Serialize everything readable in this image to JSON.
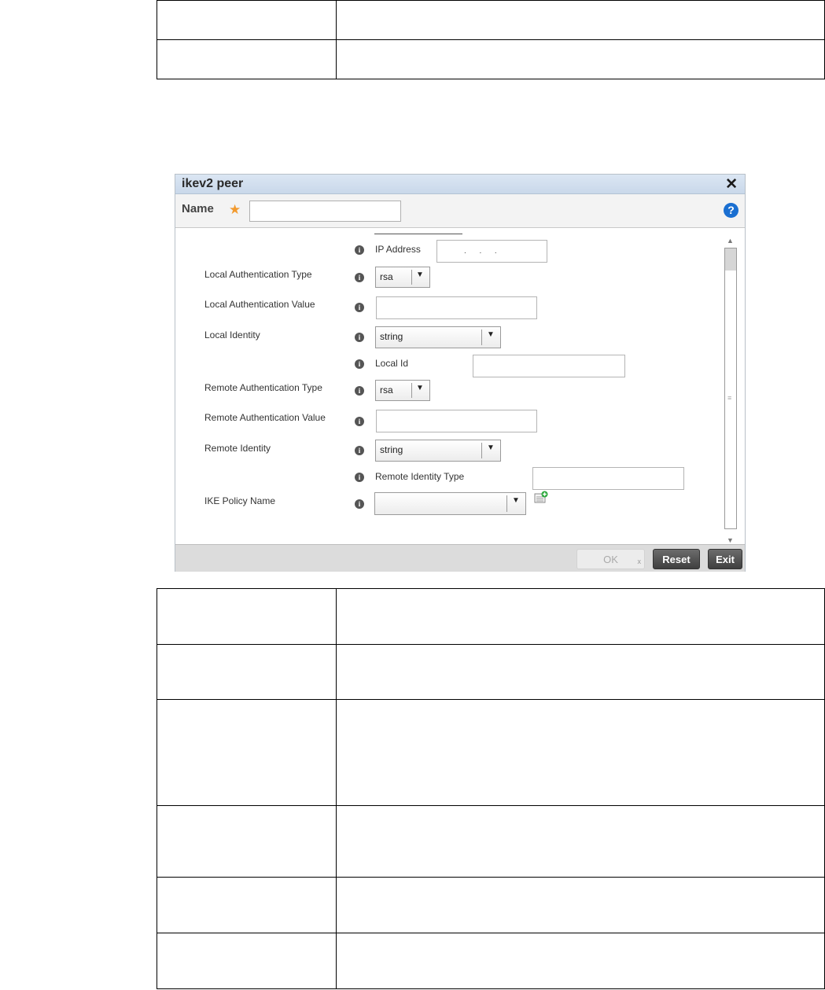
{
  "dialog": {
    "title": "ikev2 peer",
    "close_glyph": "✕",
    "name_label": "Name",
    "required_marker": "★",
    "help_glyph": "?",
    "name_value": ""
  },
  "form": {
    "ip_address_label": "IP Address",
    "ip_address_value": ".      .      .",
    "local_auth_type_label": "Local Authentication Type",
    "local_auth_type_value": "rsa",
    "local_auth_value_label": "Local Authentication Value",
    "local_identity_label": "Local Identity",
    "local_identity_value": "string",
    "local_id_label": "Local Id",
    "remote_auth_type_label": "Remote Authentication Type",
    "remote_auth_type_value": "rsa",
    "remote_auth_value_label": "Remote Authentication Value",
    "remote_identity_label": "Remote Identity",
    "remote_identity_value": "string",
    "remote_identity_type_label": "Remote Identity Type",
    "ike_policy_name_label": "IKE Policy Name",
    "ike_policy_name_value": "",
    "info_glyph": "i",
    "dropdown_glyph": "▼"
  },
  "footer": {
    "ok_label": "OK",
    "ok_clear_glyph": "x",
    "reset_label": "Reset",
    "exit_label": "Exit"
  },
  "colors": {
    "titlebar": "#c9d8ea",
    "required_star": "#f29a2e",
    "help_icon": "#1a6fd1",
    "dark_button": "#4a4a4a"
  }
}
